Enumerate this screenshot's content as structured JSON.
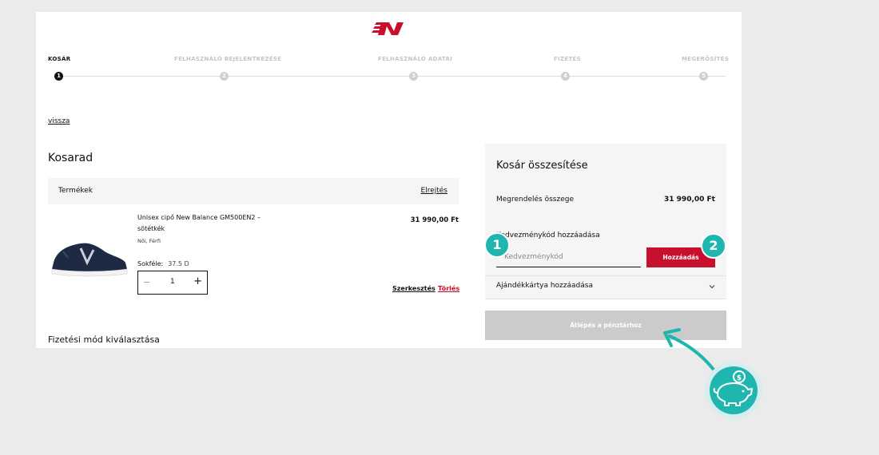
{
  "brand_color": "#c8102e",
  "accent_color": "#1fb6b0",
  "steps": [
    {
      "label": "KOSÁR",
      "number": "1",
      "active": true
    },
    {
      "label": "FELHASZNÁLÓ BEJELENTKEZÉSE",
      "number": "2",
      "active": false
    },
    {
      "label": "FELHASZNÁLÓ ADATAI",
      "number": "3",
      "active": false
    },
    {
      "label": "FIZETÉS",
      "number": "4",
      "active": false
    },
    {
      "label": "MEGERŐSÍTÉS",
      "number": "5",
      "active": false
    }
  ],
  "back_link": "vissza",
  "cart": {
    "title": "Kosarad",
    "products_header": "Termékek",
    "remove_all": "Elrejtés",
    "item": {
      "name": "Unisex cipő New Balance GM500EN2 – sötétkék",
      "gender": "Női, Férfi",
      "size_label": "Sokféle:",
      "size_value": "37.5 D",
      "price": "31 990,00 Ft",
      "quantity": "1",
      "edit": "Szerkesztés",
      "delete": "Törlés"
    },
    "payment_title": "Fizetési mód kiválasztása"
  },
  "summary": {
    "title": "Kosár összesítése",
    "order_total_label": "Megrendelés összege",
    "order_total_value": "31 990,00 Ft",
    "coupon_label": "Kedvezménykód hozzáadása",
    "coupon_placeholder": "Kedvezménykód",
    "add_button": "Hozzáadás",
    "giftcard_label": "Ajándékkártya hozzáadása",
    "checkout_button": "Átlépés a pénztárhoz"
  },
  "annotations": {
    "badge_1": "1",
    "badge_2": "2",
    "piggy_icon": "piggy-bank-coin-icon"
  }
}
